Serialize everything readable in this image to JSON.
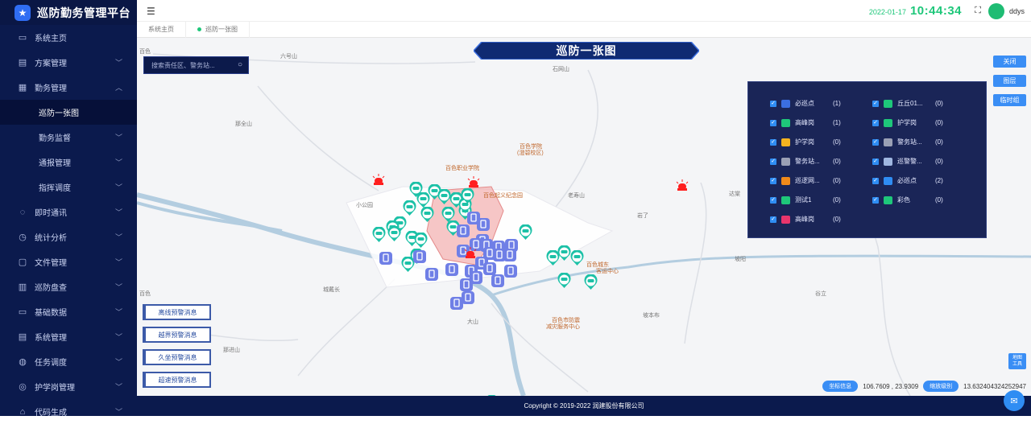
{
  "app": {
    "title": "巡防勤务管理平台"
  },
  "sidebar": {
    "items": [
      {
        "label": "系统主页",
        "icon": "monitor-icon",
        "glyph": "▭",
        "has_children": false
      },
      {
        "label": "方案管理",
        "icon": "document-icon",
        "glyph": "▤",
        "has_children": true
      },
      {
        "label": "勤务管理",
        "icon": "briefcase-icon",
        "glyph": "▦",
        "has_children": true,
        "expanded": true
      },
      {
        "label": "巡防一张图",
        "icon": "",
        "glyph": "",
        "sub": true,
        "active": true
      },
      {
        "label": "勤务监督",
        "icon": "",
        "glyph": "",
        "sub": true,
        "has_children": true
      },
      {
        "label": "通报管理",
        "icon": "",
        "glyph": "",
        "sub": true,
        "has_children": true
      },
      {
        "label": "指挥调度",
        "icon": "",
        "glyph": "",
        "sub": true,
        "has_children": true
      },
      {
        "label": "即时通讯",
        "icon": "chat-icon",
        "glyph": "◌",
        "has_children": true
      },
      {
        "label": "统计分析",
        "icon": "clock-icon",
        "glyph": "◷",
        "has_children": true
      },
      {
        "label": "文件管理",
        "icon": "folder-icon",
        "glyph": "▢",
        "has_children": true
      },
      {
        "label": "巡防盘查",
        "icon": "checklist-icon",
        "glyph": "▥",
        "has_children": true
      },
      {
        "label": "基础数据",
        "icon": "data-icon",
        "glyph": "▭",
        "has_children": true
      },
      {
        "label": "系统管理",
        "icon": "settings-panel-icon",
        "glyph": "▤",
        "has_children": true
      },
      {
        "label": "任务调度",
        "icon": "schedule-icon",
        "glyph": "◍",
        "has_children": true
      },
      {
        "label": "护学岗管理",
        "icon": "shield-user-icon",
        "glyph": "◎",
        "has_children": true
      },
      {
        "label": "代码生成",
        "icon": "code-icon",
        "glyph": "⌂",
        "has_children": true
      }
    ]
  },
  "header": {
    "date": "2022-01-17",
    "time": "10:44:34",
    "username": "ddys"
  },
  "tabs": [
    {
      "label": "系统主页",
      "active": false
    },
    {
      "label": "巡防一张图",
      "active": true
    }
  ],
  "map": {
    "title": "巡防一张图",
    "search_placeholder": "搜索责任区、警务站...",
    "buttons": {
      "close": "关闭",
      "layers": "图层",
      "temp": "临时组"
    },
    "tools_label_1": "地图",
    "tools_label_2": "工具",
    "places": [
      "百色",
      "六号山",
      "石网山",
      "那全山",
      "百色学院",
      "(澄碧校区)",
      "百色职业学院",
      "小公园",
      "百色起义纪念园",
      "老寿山",
      "岩了",
      "达棠",
      "百色城东",
      "客运中心",
      "城戴长",
      "坡阳",
      "谷立",
      "大山",
      "百色市防震",
      "减灾服务中心",
      "坡本布",
      "那进山",
      "百色"
    ],
    "layers": [
      {
        "name": "必巡点",
        "count": "(1)",
        "color": "#3b6ee0"
      },
      {
        "name": "丘丘01...",
        "count": "(0)",
        "color": "#1ec77a"
      },
      {
        "name": "高峰岗",
        "count": "(1)",
        "color": "#1ec77a"
      },
      {
        "name": "护学岗",
        "count": "(0)",
        "color": "#1ec77a"
      },
      {
        "name": "护学岗",
        "count": "(0)",
        "color": "#f3b21f"
      },
      {
        "name": "警务站...",
        "count": "(0)",
        "color": "#9aa0b5"
      },
      {
        "name": "警务站...",
        "count": "(0)",
        "color": "#9aa0b5"
      },
      {
        "name": "巡警警...",
        "count": "(0)",
        "color": "#9fb6e0"
      },
      {
        "name": "巡逻网...",
        "count": "(0)",
        "color": "#f08a1a"
      },
      {
        "name": "必巡点",
        "count": "(2)",
        "color": "#2f8df3"
      },
      {
        "name": "测试1",
        "count": "(0)",
        "color": "#1ec77a"
      },
      {
        "name": "彩色",
        "count": "(0)",
        "color": "#1ec77a"
      },
      {
        "name": "高峰岗",
        "count": "(0)",
        "color": "#e8356c"
      }
    ],
    "alerts": [
      {
        "label": "离线预警消息"
      },
      {
        "label": "越界预警消息"
      },
      {
        "label": "久坐预警消息"
      },
      {
        "label": "超速预警消息"
      }
    ],
    "coord_label": "坐标信息",
    "coord_value": "106.7609 , 23.9309",
    "zoom_label": "缩放级别",
    "zoom_value": "13.632404324252947"
  },
  "footer": {
    "copyright": "Copyright © 2019-2022 润建股份有限公司"
  },
  "colors": {
    "sidebar_bg": "#0b1a4d",
    "accent_green": "#1ec77a",
    "accent_blue": "#3a8ef5",
    "car_marker": "#1cc1a7",
    "officer_marker": "#6f7fe6",
    "alarm_red": "#ff1f1f"
  }
}
